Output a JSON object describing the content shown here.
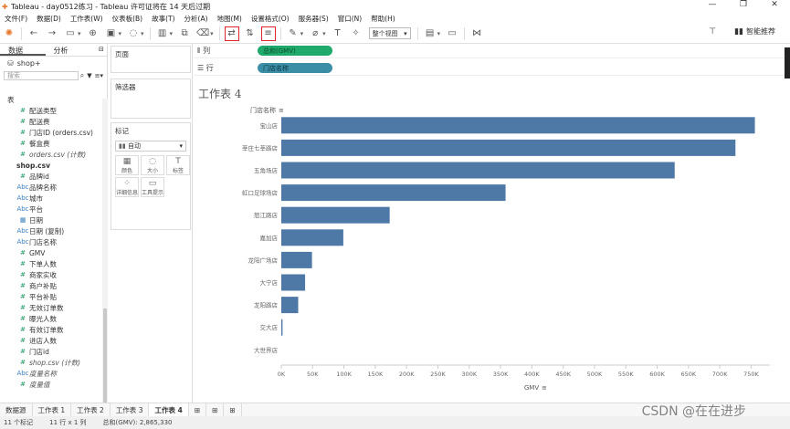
{
  "window": {
    "title": "Tableau - day0512练习 - Tableau 许可证将在 14 天后过期",
    "controls": [
      "—",
      "❐",
      "✕"
    ]
  },
  "menu": [
    "文件(F)",
    "数据(D)",
    "工作表(W)",
    "仪表板(B)",
    "故事(T)",
    "分析(A)",
    "地图(M)",
    "设置格式(O)",
    "服务器(S)",
    "窗口(N)",
    "帮助(H)"
  ],
  "toolbar": {
    "view_select": "整个视图",
    "smart_label": "智能推荐"
  },
  "data_pane": {
    "tabs": [
      "数据",
      "分析"
    ],
    "source": "shop+",
    "search_placeholder": "搜索",
    "table_header": "表",
    "fields": [
      {
        "icon": "#",
        "label": "配送类型",
        "type": "measure"
      },
      {
        "icon": "#",
        "label": "配送费",
        "type": "measure"
      },
      {
        "icon": "#",
        "label": "门店ID (orders.csv)",
        "type": "measure"
      },
      {
        "icon": "#",
        "label": "餐盒费",
        "type": "measure"
      },
      {
        "icon": "#",
        "label": "orders.csv (计数)",
        "type": "measure-italic"
      },
      {
        "icon": "▸",
        "label": "shop.csv",
        "type": "section"
      },
      {
        "icon": "#",
        "label": "品牌id",
        "type": "measure"
      },
      {
        "icon": "Abc",
        "label": "品牌名称",
        "type": "dim"
      },
      {
        "icon": "Abc",
        "label": "城市",
        "type": "dim"
      },
      {
        "icon": "Abc",
        "label": "平台",
        "type": "dim"
      },
      {
        "icon": "▦",
        "label": "日期",
        "type": "dim"
      },
      {
        "icon": "Abc",
        "label": "日期 (复制)",
        "type": "dim"
      },
      {
        "icon": "Abc",
        "label": "门店名称",
        "type": "dim"
      },
      {
        "icon": "#",
        "label": "GMV",
        "type": "measure"
      },
      {
        "icon": "#",
        "label": "下单人数",
        "type": "measure"
      },
      {
        "icon": "#",
        "label": "商家实收",
        "type": "measure"
      },
      {
        "icon": "#",
        "label": "商户补贴",
        "type": "measure"
      },
      {
        "icon": "#",
        "label": "平台补贴",
        "type": "measure"
      },
      {
        "icon": "#",
        "label": "无效订单数",
        "type": "measure"
      },
      {
        "icon": "#",
        "label": "曝光人数",
        "type": "measure"
      },
      {
        "icon": "#",
        "label": "有效订单数",
        "type": "measure"
      },
      {
        "icon": "#",
        "label": "进店人数",
        "type": "measure"
      },
      {
        "icon": "#",
        "label": "门店id",
        "type": "measure"
      },
      {
        "icon": "#",
        "label": "shop.csv (计数)",
        "type": "measure-italic"
      },
      {
        "icon": "Abc",
        "label": "度量名称",
        "type": "dim-italic"
      },
      {
        "icon": "#",
        "label": "度量值",
        "type": "measure-italic"
      }
    ]
  },
  "pages": {
    "title": "页面"
  },
  "filters": {
    "title": "筛选器"
  },
  "marks": {
    "title": "标记",
    "type": "自动",
    "buttons": [
      {
        "icon": "▦",
        "label": "颜色"
      },
      {
        "icon": "◌",
        "label": "大小"
      },
      {
        "icon": "T",
        "label": "标签"
      },
      {
        "icon": "⁘",
        "label": "详细信息"
      },
      {
        "icon": "▭",
        "label": "工具提示"
      }
    ]
  },
  "shelves": {
    "columns_label": "列",
    "columns_pill": "总和(GMV)",
    "rows_label": "行",
    "rows_pill": "门店名称"
  },
  "sheet": {
    "title": "工作表 4"
  },
  "chart_data": {
    "type": "bar",
    "orientation": "horizontal",
    "row_header": "门店名称",
    "xlabel": "GMV",
    "categories": [
      "宝山店",
      "莘庄七莘路店",
      "五角场店",
      "虹口足球场店",
      "怒江路店",
      "嘉加店",
      "龙阳广场店",
      "大宁店",
      "龙阳路店",
      "交大店",
      "大世界店"
    ],
    "values": [
      756000,
      725000,
      628000,
      358000,
      173000,
      99000,
      49000,
      38000,
      27000,
      2000,
      0
    ],
    "xlim": [
      0,
      780000
    ],
    "xticks": [
      0,
      50000,
      100000,
      150000,
      200000,
      250000,
      300000,
      350000,
      400000,
      450000,
      500000,
      550000,
      600000,
      650000,
      700000,
      750000
    ],
    "xtick_labels": [
      "0K",
      "50K",
      "100K",
      "150K",
      "200K",
      "250K",
      "300K",
      "350K",
      "400K",
      "450K",
      "500K",
      "550K",
      "600K",
      "650K",
      "700K",
      "750K"
    ],
    "bar_color": "#4e79a7",
    "grid": false
  },
  "bottom_tabs": [
    "数据源",
    "工作表 1",
    "工作表 2",
    "工作表 3",
    "工作表 4"
  ],
  "status": {
    "marks": "11 个标记",
    "rowscols": "11 行 x 1 列",
    "sum": "总和(GMV): 2,865,330"
  },
  "watermark": "CSDN @在在进步"
}
